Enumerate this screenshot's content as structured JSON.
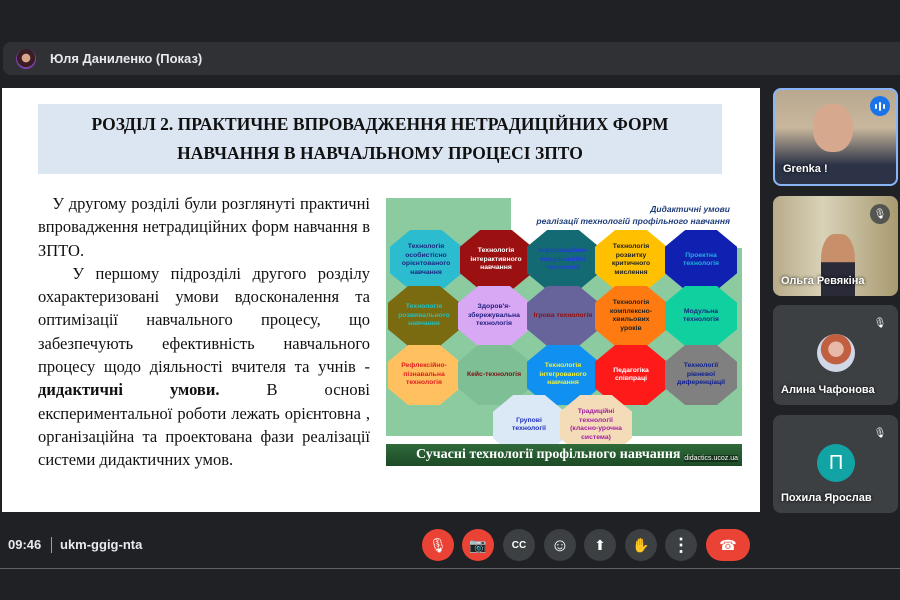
{
  "presenter": {
    "name": "Юля Даниленко (Показ)"
  },
  "slide": {
    "title_line1": "РОЗДІЛ 2. ПРАКТИЧНЕ ВПРОВАДЖЕННЯ НЕТРАДИЦІЙНИХ ФОРМ",
    "title_line2": "НАВЧАННЯ В НАВЧАЛЬНОМУ ПРОЦЕСІ ЗПТО",
    "para1": "У другому розділі були розглянуті практичні впровадження нетрадиційних форм навчання в ЗПТО.",
    "para2_a": "У першому підрозділі другого розділу охарактеризовані умови вдосконалення та оптимізації навчального процесу, що забезпечують ефективність навчального процесу щодо діяльності вчителя та учнів - ",
    "para2_bold": "дидактичні умови.",
    "para2_b": " В основі експериментальної роботи лежать орієнтовна , організаційна та проектована фази реалізації системи дидактичних умов."
  },
  "diagram": {
    "title_line1": "Дидактичні умови",
    "title_line2": "реалізації технологій профільного навчання",
    "band": "Сучасні технології профільного навчання",
    "source": "didactics.ucoz.ua",
    "octagons": [
      {
        "label": "Технологія особистісно орієнтованого навчання",
        "bg": "#2bbcd0",
        "fg": "#1a2a80"
      },
      {
        "label": "Технологія інтерактивного навчання",
        "bg": "#9b1010",
        "fg": "#ffffff"
      },
      {
        "label": "Інформаційно-комунікаційні технології",
        "bg": "#136a72",
        "fg": "#2040d0"
      },
      {
        "label": "Технологія розвитку критичного мислення",
        "bg": "#ffc000",
        "fg": "#222222"
      },
      {
        "label": "Проектна технологія",
        "bg": "#1020b0",
        "fg": "#20b0e0"
      },
      {
        "label": "Технологія розвивального навчання",
        "bg": "#7a6a10",
        "fg": "#20c0c0"
      },
      {
        "label": "Здоров'я-збережувальна технологія",
        "bg": "#d9a8f5",
        "fg": "#202080"
      },
      {
        "label": "Ігрова технологія",
        "bg": "#66649a",
        "fg": "#901010"
      },
      {
        "label": "Технологія комплексно-хвильових уроків",
        "bg": "#ff7a10",
        "fg": "#222222"
      },
      {
        "label": "Модульна технологія",
        "bg": "#10d0a0",
        "fg": "#1a2a80"
      },
      {
        "label": "Рефлексійно-пізнавальна технологія",
        "bg": "#ffc060",
        "fg": "#e02020"
      },
      {
        "label": "Кейс-технологія",
        "bg": "#7fbf95",
        "fg": "#7a1010"
      },
      {
        "label": "Технологія інтегрованого навчання",
        "bg": "#1090f0",
        "fg": "#f0f040"
      },
      {
        "label": "Педагогіка співпраці",
        "bg": "#ff1a1a",
        "fg": "#ffffff"
      },
      {
        "label": "Технології рівневої диференціації",
        "bg": "#808080",
        "fg": "#102090"
      },
      {
        "label": "Групові технології",
        "bg": "#dbe8f5",
        "fg": "#2030c0"
      },
      {
        "label": "Традиційні технології (класно-урочна система)",
        "bg": "#f5dcb8",
        "fg": "#a020a0"
      }
    ]
  },
  "participants": [
    {
      "name": "Grenka !",
      "speaking": true
    },
    {
      "name": "Ольга Ревякіна",
      "muted": true
    },
    {
      "name": "Алина Чафонова",
      "muted": true
    },
    {
      "name": "Похила Ярослав",
      "muted": true,
      "initial": "П",
      "avatar_color": "#12a4a4"
    }
  ],
  "meeting": {
    "time": "09:46",
    "code": "ukm-ggig-nta"
  },
  "controls": {
    "mic": "🎙",
    "camera": "📷",
    "captions": "CC",
    "emoji": "☺",
    "present": "⬆",
    "hand": "✋",
    "more": "⋮",
    "hangup": "☎"
  }
}
